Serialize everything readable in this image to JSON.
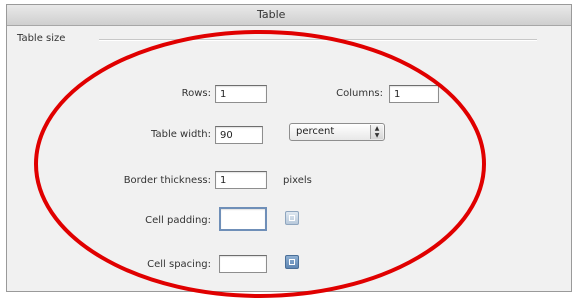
{
  "window": {
    "title": "Table"
  },
  "section": {
    "label": "Table size"
  },
  "fields": {
    "rows": {
      "label": "Rows:",
      "value": "1"
    },
    "columns": {
      "label": "Columns:",
      "value": "1"
    },
    "table_width": {
      "label": "Table width:",
      "value": "90",
      "unit": "percent"
    },
    "border_thickness": {
      "label": "Border thickness:",
      "value": "1",
      "unit": "pixels"
    },
    "cell_padding": {
      "label": "Cell padding:",
      "value": ""
    },
    "cell_spacing": {
      "label": "Cell spacing:",
      "value": ""
    }
  },
  "icons": {
    "unit_stepper": "up-down-arrows-icon",
    "cell_padding_picker": "cell-padding-icon",
    "cell_spacing_picker": "cell-spacing-icon"
  },
  "colors": {
    "annotation_oval": "#e00000",
    "dialog_background": "#f1f1f1"
  }
}
